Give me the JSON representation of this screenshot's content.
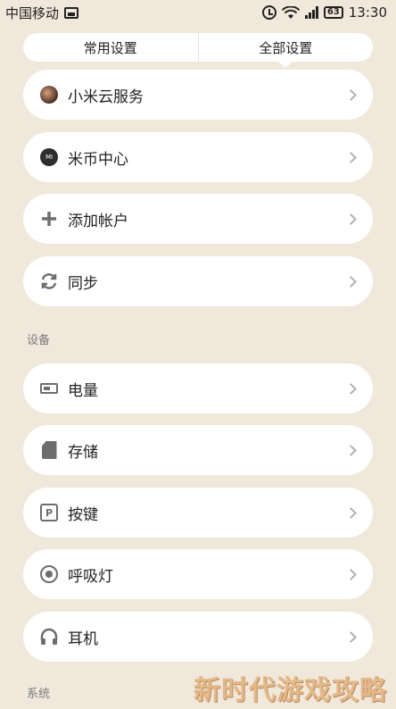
{
  "status_bar": {
    "carrier": "中国移动",
    "battery": "63",
    "time": "13:30"
  },
  "tabs": [
    {
      "label": "常用设置",
      "active": false
    },
    {
      "label": "全部设置",
      "active": true
    }
  ],
  "accounts": [
    {
      "label": "小米云服务",
      "icon": "mi-cloud-avatar-icon"
    },
    {
      "label": "米币中心",
      "icon": "mi-coin-icon"
    },
    {
      "label": "添加帐户",
      "icon": "plus-icon"
    },
    {
      "label": "同步",
      "icon": "sync-icon"
    }
  ],
  "device_section": {
    "title": "设备",
    "items": [
      {
        "label": "电量",
        "icon": "battery-icon"
      },
      {
        "label": "存储",
        "icon": "sd-card-icon"
      },
      {
        "label": "按键",
        "icon": "button-icon"
      },
      {
        "label": "呼吸灯",
        "icon": "led-icon"
      },
      {
        "label": "耳机",
        "icon": "headphones-icon"
      }
    ]
  },
  "system_section": {
    "title": "系统"
  },
  "watermark": "新时代游戏攻略",
  "colors": {
    "background": "#f1e8dc",
    "card": "#ffffff",
    "watermark": "#e4b98a"
  }
}
